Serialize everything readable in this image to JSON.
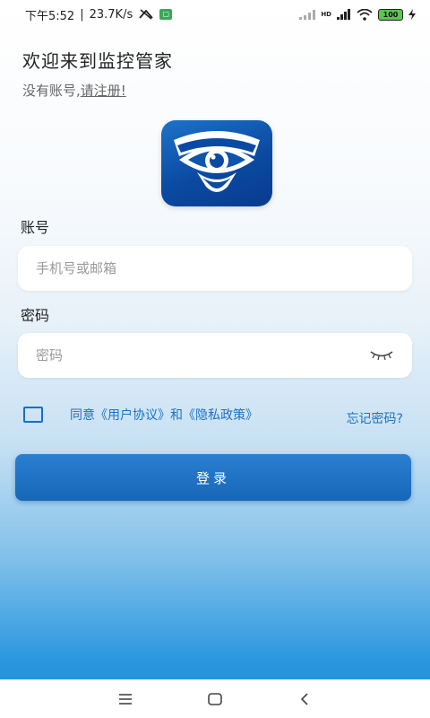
{
  "status_bar": {
    "time": "下午5:52",
    "speed": "23.7K/s",
    "battery": "100",
    "network": "HD"
  },
  "welcome": {
    "title": "欢迎来到监控管家",
    "no_account": "没有账号,",
    "register_link": "请注册!"
  },
  "account": {
    "label": "账号",
    "placeholder": "手机号或邮箱"
  },
  "password": {
    "label": "密码",
    "placeholder": "密码"
  },
  "agreement": {
    "checked": false,
    "text": "同意《用户协议》和《隐私政策》"
  },
  "forgot_password": "忘记密码?",
  "login_button": "登录",
  "colors": {
    "accent": "#1d72c3",
    "button": "#1767b9",
    "logo": "#0b4aa2"
  },
  "icons": {
    "logo": "eye-shield-logo",
    "password_toggle": "closed-eye-icon",
    "nav": [
      "menu-icon",
      "home-square-icon",
      "back-chevron-icon"
    ]
  }
}
